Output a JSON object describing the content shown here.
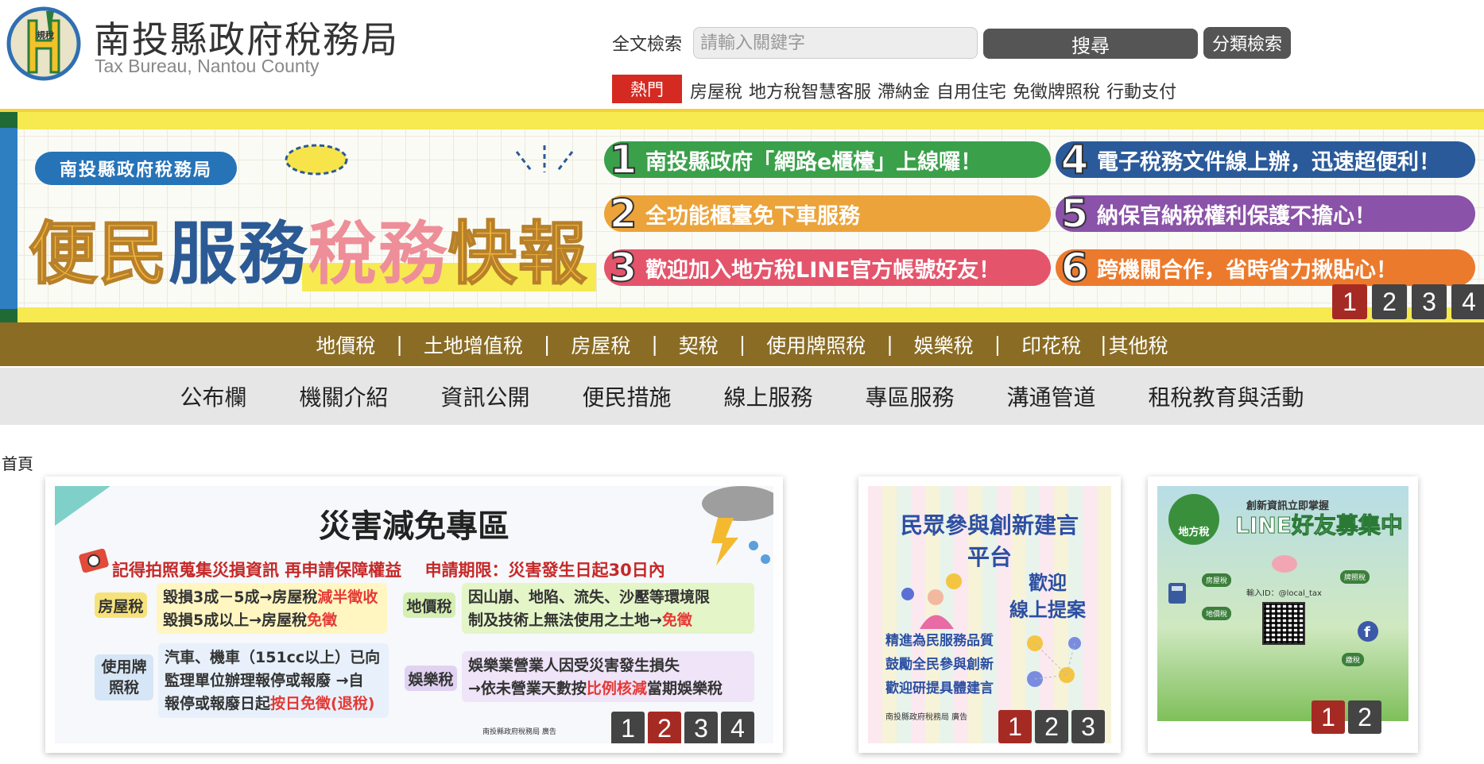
{
  "header": {
    "logo_label": "規稅",
    "title": "南投縣政府稅務局",
    "subtitle": "Tax Bureau, Nantou County"
  },
  "search": {
    "label": "全文檢索",
    "placeholder": "請輸入關鍵字",
    "button": "搜尋",
    "category_button": "分類檢索"
  },
  "hot": {
    "tag": "熱門",
    "links": [
      "房屋稅",
      "地方稅智慧客服",
      "滯納金",
      "自用住宅",
      "免徵牌照稅",
      "行動支付"
    ]
  },
  "banner": {
    "pill": "南投縣政府稅務局",
    "headline_1": "便民",
    "headline_2": "服務",
    "headline_3": "稅務",
    "headline_4": "快報",
    "features": [
      {
        "num": "1",
        "text": "南投縣政府「網路e櫃檯」上線囉！",
        "color": "#3aa04a"
      },
      {
        "num": "2",
        "text": "全功能櫃臺免下車服務",
        "color": "#eba33a"
      },
      {
        "num": "3",
        "text": "歡迎加入地方稅LINE官方帳號好友！",
        "color": "#e4546b"
      },
      {
        "num": "4",
        "text": "電子稅務文件線上辦，迅速超便利！",
        "color": "#2a5a9a"
      },
      {
        "num": "5",
        "text": "納保官納稅權利保護不擔心！",
        "color": "#8a52a8"
      },
      {
        "num": "6",
        "text": "跨機關合作，省時省力揪貼心！",
        "color": "#ec7a2c"
      }
    ],
    "slides": [
      "1",
      "2",
      "3",
      "4"
    ],
    "active_slide": "1"
  },
  "tax_nav": [
    "地價稅",
    "土地增值稅",
    "房屋稅",
    "契稅",
    "使用牌照稅",
    "娛樂稅",
    "印花稅",
    "其他稅"
  ],
  "main_nav": [
    "公布欄",
    "機關介紹",
    "資訊公開",
    "便民措施",
    "線上服務",
    "專區服務",
    "溝通管道",
    "租稅教育與活動"
  ],
  "breadcrumb": "首頁",
  "card1": {
    "title": "災害減免專區",
    "subtitle_left": "記得拍照蒐集災損資訊 再申請保障權益",
    "subtitle_right": "申請期限：災害發生日起30日內",
    "house_tag": "房屋稅",
    "house_line1_a": "毀損3成－5成→房屋稅",
    "house_line1_b": "減半徵收",
    "house_line2_a": "毀損5成以上→房屋稅",
    "house_line2_b": "免徵",
    "land_tag": "地價稅",
    "land_line1": "因山崩、地陷、流失、沙壓等環境限",
    "land_line2_a": "制及技術上無法使用之土地→",
    "land_line2_b": "免徵",
    "vehicle_tag_1": "使用牌",
    "vehicle_tag_2": "照稅",
    "vehicle_line1": "汽車、機車（151cc以上）已向",
    "vehicle_line2": "監理單位辦理報停或報廢 →自",
    "vehicle_line3_a": "報停或報廢日起",
    "vehicle_line3_b": "按日免徵(退稅)",
    "ent_tag": "娛樂稅",
    "ent_line1": "娛樂業營業人因受災害發生損失",
    "ent_line2_a": "→依未營業天數按",
    "ent_line2_b": "比例核減",
    "ent_line2_c": "當期娛樂稅",
    "footer": "南投縣政府稅務局 廣告",
    "slides": [
      "1",
      "2",
      "3",
      "4"
    ],
    "active_slide": "2"
  },
  "card2": {
    "title_1": "民眾參與創新建言",
    "title_2": "平台",
    "welcome_1": "歡迎",
    "welcome_2": "線上提案",
    "text_1": "精進為民服務品質",
    "text_2": "鼓勵全民參與創新",
    "text_3": "歡迎研提具體建言",
    "footer": "南投縣政府稅務局 廣告",
    "slides": [
      "1",
      "2",
      "3"
    ],
    "active_slide": "1"
  },
  "card3": {
    "top": "創新資訊立即掌握",
    "title": "LINE好友募集中",
    "logo": "地方稅",
    "handle": "輸入ID：@local_tax",
    "slides": [
      "1",
      "2"
    ],
    "active_slide": "1"
  }
}
